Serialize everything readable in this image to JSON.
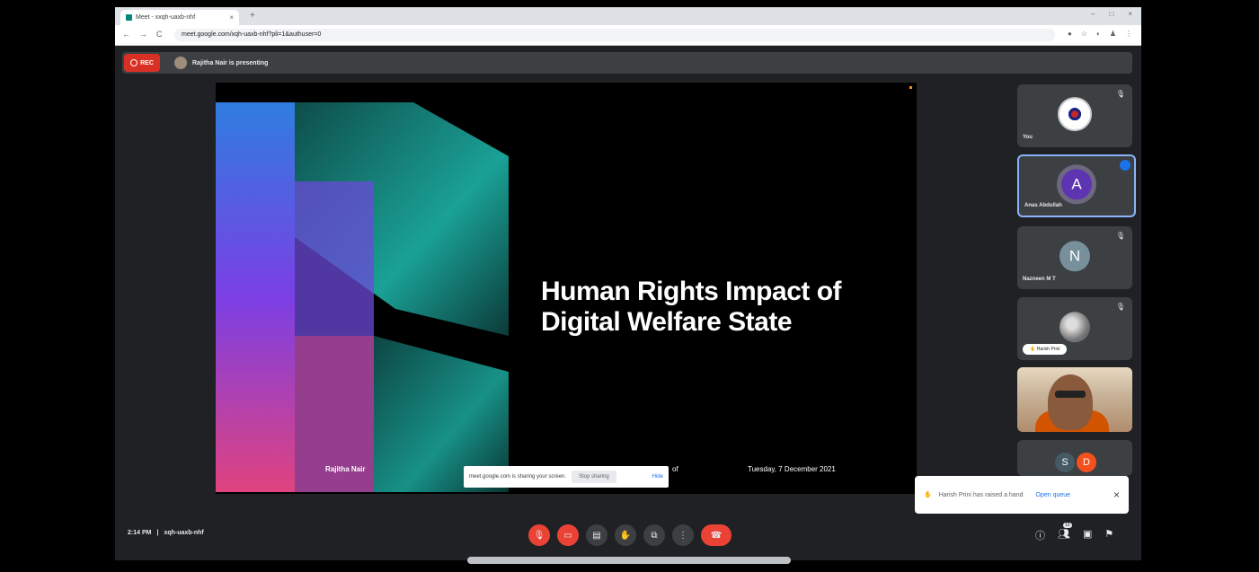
{
  "browser": {
    "tab_title": "Meet - xxqh-uaxb-nhf",
    "tab_close": "×",
    "new_tab": "+",
    "window_controls": [
      "–",
      "□",
      "×"
    ],
    "url": "meet.google.com/xqh-uaxb-nhf?pli=1&authuser=0",
    "nav": [
      "←",
      "→",
      "C"
    ]
  },
  "meet": {
    "rec_label": "REC",
    "presenting_text": "Rajitha Nair is presenting"
  },
  "slide": {
    "title_line1": "Human Rights Impact of",
    "title_line2": "Digital Welfare State",
    "presenter_name": "Rajitha Nair",
    "of_word": "of",
    "date": "Tuesday, 7 December 2021",
    "accent_colors": [
      "#1a9b8f",
      "#7b3fe4",
      "#e0437f",
      "#3a6de0"
    ]
  },
  "share_banner": {
    "text": "meet.google.com is sharing your screen.",
    "stop_label": "Stop sharing",
    "hide_label": "Hide"
  },
  "participants": [
    {
      "name": "You",
      "type": "logo"
    },
    {
      "name": "Anas Abdullah",
      "initial": "A",
      "color": "#5e35b1",
      "speaking": true
    },
    {
      "name": "Nazneen M T",
      "initial": "N",
      "color": "#78909c"
    },
    {
      "name": "Harish Prini",
      "type": "photo"
    },
    {
      "name": "",
      "type": "camera"
    },
    {
      "initials": [
        "S",
        "D"
      ],
      "colors": [
        "#455a64",
        "#f4511e"
      ]
    }
  ],
  "notification": {
    "text": "Harish Prini has raised a hand",
    "action": "Open queue",
    "close": "×"
  },
  "bottom": {
    "time": "2:14 PM",
    "separator": "|",
    "meeting_code": "xqh-uaxb-nhf",
    "people_count": "10"
  }
}
